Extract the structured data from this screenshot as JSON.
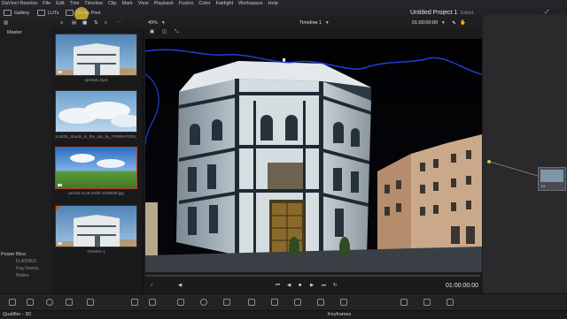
{
  "menu": [
    "DaVinci Resolve",
    "File",
    "Edit",
    "Trim",
    "Timeline",
    "Clip",
    "Mark",
    "View",
    "Playback",
    "Fusion",
    "Color",
    "Fairlight",
    "Workspace",
    "Help"
  ],
  "toolbar": {
    "gallery_label": "Gallery",
    "luts_label": "LUTs",
    "media_pool_label": "Media Pool",
    "project_title": "Untitled Project 1",
    "edited_label": "Edited"
  },
  "viewer": {
    "zoom": "49%",
    "timeline_name": "Timeline 1",
    "timecode_top": "01:00:00:00",
    "timecode_bottom": "01:00:00:00"
  },
  "left_panel": {
    "master_label": "Master",
    "power_bins_label": "Power Bins",
    "bins": [
      "FLASHES",
      "Fog Overla...",
      "Nubes"
    ]
  },
  "media_pool": {
    "clips": [
      {
        "name": "ejemplo.mp4",
        "selected": false
      },
      {
        "name": "114836_clouds_in_the_sky_by_FORMATION_mo...",
        "selected": false
      },
      {
        "name": "pexels-scott-webb-1048039.jpg",
        "selected": true
      },
      {
        "name": "Timeline 1",
        "selected": false
      }
    ]
  },
  "nodes": {
    "node_label": "01"
  },
  "status": {
    "qualifier_label": "Qualifier - 3D",
    "keyframes_label": "Keyframes"
  },
  "colors": {
    "accent_red": "#c0392b",
    "mask_stroke": "#1f3dd6",
    "background": "#1b1b1d"
  }
}
